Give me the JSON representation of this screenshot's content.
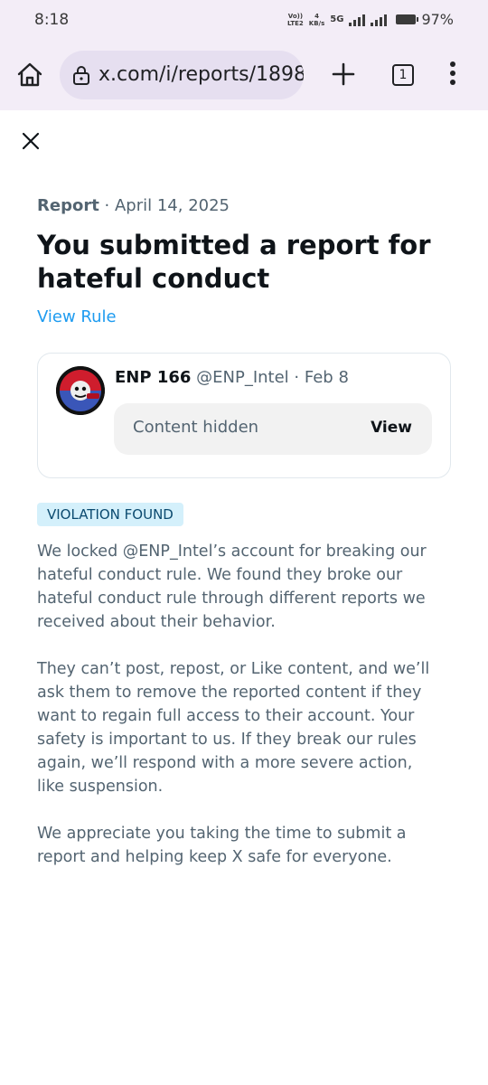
{
  "status_bar": {
    "time": "8:18",
    "volte": "Vo))",
    "lte": "LTE2",
    "speed_value": "4",
    "speed_unit": "KB/s",
    "network": "5G",
    "battery": "97%"
  },
  "browser": {
    "url": "x.com/i/reports/1898",
    "tab_count": "1"
  },
  "report": {
    "label": "Report",
    "separator": " · ",
    "date": "April 14, 2025",
    "title": "You submitted a report for hateful conduct",
    "view_rule": "View Rule",
    "post": {
      "name": "ENP 166",
      "handle": "@ENP_Intel",
      "separator": " · ",
      "date": "Feb 8",
      "hidden_text": "Content hidden",
      "view_label": "View"
    },
    "badge": "VIOLATION FOUND",
    "paragraphs": [
      "We locked @ENP_Intel’s account for breaking our hateful conduct rule. We found they broke our hateful conduct rule through different reports we received about their behavior.",
      "They can’t post, repost, or Like content, and we’ll ask them to remove the reported content if they want to regain full access to their account. Your safety is important to us. If they break our rules again, we’ll respond with a more severe action, like suspension.",
      "We appreciate you taking the time to submit a report and helping keep X safe for everyone."
    ]
  }
}
